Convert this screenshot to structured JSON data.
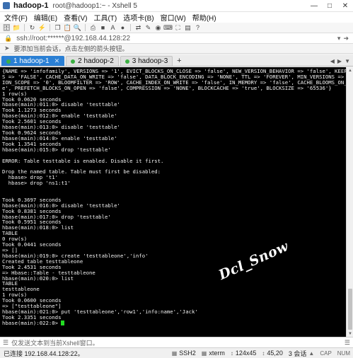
{
  "window": {
    "title": "hadoop-1",
    "subtitle": "root@hadoop1:~ - Xshell 5"
  },
  "menu": [
    "文件(F)",
    "编辑(E)",
    "查看(V)",
    "工具(T)",
    "选项卡(B)",
    "窗口(W)",
    "帮助(H)"
  ],
  "address": {
    "text": "ssh://root:******@192.168.44.128:22"
  },
  "info_bar": {
    "text": "要添加当前会话，点击左侧的箭头按钮。"
  },
  "tabs": [
    {
      "label": "1 hadoop-1",
      "active": true
    },
    {
      "label": "2 hadoop-2",
      "active": false
    },
    {
      "label": "3 hadoop-3",
      "active": false
    }
  ],
  "terminal": {
    "lines": [
      "{NAME => 'infofamily', VERSIONS => '1', EVICT_BLOCKS_ON_CLOSE => 'false', NEW_VERSION_BEHAVIOR => 'false', KEEP_DELETED_CELL",
      "S => 'FALSE', CACHE_DATA_ON_WRITE => 'false', DATA_BLOCK_ENCODING => 'NONE', TTL => 'FOREVER', MIN_VERSIONS => '0', REPLICAT",
      "ION_SCOPE => '0', BLOOMFILTER => 'ROW', CACHE_INDEX_ON_WRITE => 'false', IN_MEMORY => 'false', CACHE_BLOOMS_ON_WRITE => 'fals",
      "e', PREFETCH_BLOCKS_ON_OPEN => 'false', COMPRESSION => 'NONE', BLOCKCACHE => 'true', BLOCKSIZE => '65536'}",
      "1 row(s)",
      "Took 0.0620 seconds",
      "hbase(main):011:0> disable 'testtable'",
      "Took 1.1273 seconds",
      "hbase(main):012:0> enable 'testtable'",
      "Took 2.5601 seconds",
      "hbase(main):013:0> disable 'testtable'",
      "Took 0.9624 seconds",
      "hbase(main):014:0> enable 'testtable'",
      "Took 1.3541 seconds",
      "hbase(main):015:0> drop 'testtable'",
      "",
      "ERROR: Table testtable is enabled. Disable it first.",
      "",
      "Drop the named table. Table must first be disabled:",
      "  hbase> drop 't1'",
      "  hbase> drop 'ns1:t1'",
      "",
      "",
      "Took 0.3697 seconds",
      "hbase(main):016:0> disable 'testtable'",
      "Took 0.8381 seconds",
      "hbase(main):017:0> drop 'testtable'",
      "Took 0.5951 seconds",
      "hbase(main):018:0> list",
      "TABLE",
      "0 row(s)",
      "Took 0.0441 seconds",
      "=> []",
      "hbase(main):019:0> create 'testtableone','info'",
      "Created table testtableone",
      "Took 2.4531 seconds",
      "=> Hbase::Table - testtableone",
      "hbase(main):020:0> list",
      "TABLE",
      "testtableone",
      "1 row(s)",
      "Took 0.0600 seconds",
      "=> [\"testtableone\"]",
      "hbase(main):021:0> put 'testtableone','row1','info:name','Jack'",
      "Took 2.3351 seconds"
    ],
    "prompt": "hbase(main):022:0> ",
    "watermark": "Dcl_Snow"
  },
  "compose_bar": {
    "text": "仅发送文本到当前Xshell窗口。"
  },
  "status_bar": {
    "connection": "已连接 192.168.44.128:22。",
    "protocol": "SSH2",
    "terminal_type": "xterm",
    "size": "124x45",
    "cursor_pos": "45,20",
    "sessions": "3 会话",
    "caps": "CAP",
    "num": "NUM"
  },
  "colors": {
    "terminal_bg": "#000000",
    "terminal_fg": "#f2f2f2",
    "cursor": "#22dd22",
    "active_tab": "#2a7fd4",
    "status_dot": "#3cb043"
  }
}
